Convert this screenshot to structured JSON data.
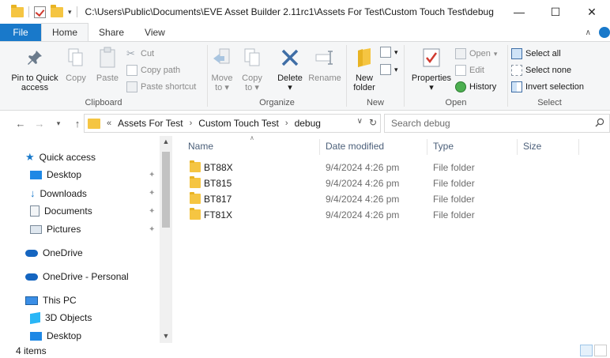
{
  "titlebar": {
    "path": "C:\\Users\\Public\\Documents\\EVE Asset Builder 2.11rc1\\Assets For Test\\Custom Touch Test\\debug",
    "minimize": "—",
    "maximize": "☐",
    "close": "✕"
  },
  "ribbon_tabs": {
    "file": "File",
    "home": "Home",
    "share": "Share",
    "view": "View"
  },
  "clipboard": {
    "pin_line1": "Pin to Quick",
    "pin_line2": "access",
    "copy": "Copy",
    "paste": "Paste",
    "cut": "Cut",
    "copy_path": "Copy path",
    "paste_shortcut": "Paste shortcut",
    "label": "Clipboard"
  },
  "organize": {
    "move_to_line1": "Move",
    "move_to_line2": "to",
    "copy_to_line1": "Copy",
    "copy_to_line2": "to",
    "delete": "Delete",
    "rename": "Rename",
    "label": "Organize"
  },
  "new_group": {
    "new_folder_line1": "New",
    "new_folder_line2": "folder",
    "label": "New"
  },
  "open_group": {
    "properties": "Properties",
    "open": "Open",
    "edit": "Edit",
    "history": "History",
    "label": "Open"
  },
  "select_group": {
    "select_all": "Select all",
    "select_none": "Select none",
    "invert": "Invert selection",
    "label": "Select"
  },
  "address": {
    "overflow": "«",
    "crumbs": [
      "Assets For Test",
      "Custom Touch Test",
      "debug"
    ],
    "search_placeholder": "Search debug"
  },
  "navpane": {
    "quick_access": "Quick access",
    "desktop": "Desktop",
    "downloads": "Downloads",
    "documents": "Documents",
    "pictures": "Pictures",
    "onedrive": "OneDrive",
    "onedrive_personal": "OneDrive - Personal",
    "this_pc": "This PC",
    "objects3d": "3D Objects",
    "desktop2": "Desktop"
  },
  "columns": {
    "name": "Name",
    "date": "Date modified",
    "type": "Type",
    "size": "Size"
  },
  "files": [
    {
      "name": "BT88X",
      "date": "9/4/2024 4:26 pm",
      "type": "File folder"
    },
    {
      "name": "BT815",
      "date": "9/4/2024 4:26 pm",
      "type": "File folder"
    },
    {
      "name": "BT817",
      "date": "9/4/2024 4:26 pm",
      "type": "File folder"
    },
    {
      "name": "FT81X",
      "date": "9/4/2024 4:26 pm",
      "type": "File folder"
    }
  ],
  "status": {
    "count": "4 items"
  },
  "colors": {
    "accent": "#1979ca",
    "folder": "#f5c542",
    "ribbon_bg": "#f5f6f7"
  }
}
